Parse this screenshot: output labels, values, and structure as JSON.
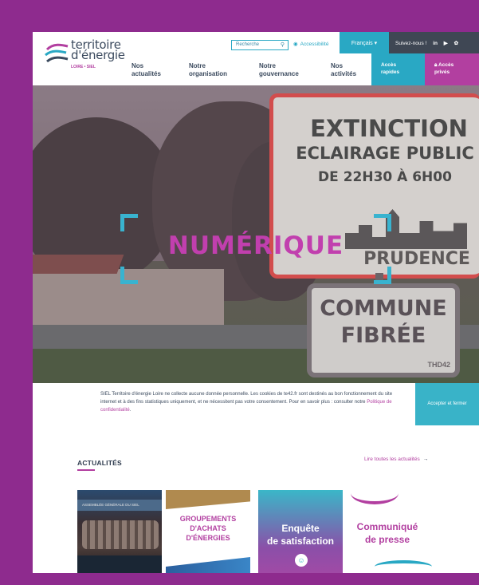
{
  "header": {
    "logo_line1": "territoire",
    "logo_line2": "d'énergie",
    "logo_sub": "LOIRE • SIEL",
    "search_placeholder": "Recherche",
    "accessibility": "Accessibilité",
    "language": "Français ▾",
    "follow": "Suivez-nous !",
    "social": [
      "in",
      "▶",
      "✿"
    ],
    "nav": [
      {
        "line1": "Nos",
        "line2": "actualités"
      },
      {
        "line1": "Notre",
        "line2": "organisation"
      },
      {
        "line1": "Notre",
        "line2": "gouvernance"
      },
      {
        "line1": "Nos",
        "line2": "activités"
      }
    ],
    "quick_access": {
      "line1": "Accès",
      "line2": "rapides"
    },
    "private_access": {
      "line1": "Accès",
      "line2": "privés"
    }
  },
  "hero": {
    "sign1": [
      "EXTINCTION",
      "ECLAIRAGE PUBLIC",
      "DE 22H30 À 6H00",
      "PRUDENCE"
    ],
    "sign2": [
      "COMMUNE",
      "FIBRÉE",
      "THD42"
    ],
    "focus_title": "NUMÉRIQUE"
  },
  "cookie": {
    "text": "SIEL Territoire d'énergie Loire ne collecte aucune donnée personnelle. Les cookies de te42.fr sont destinés au bon fonctionnement du site internet et à des fins statistiques uniquement, et ne nécessitent pas votre consentement. Pour en savoir plus : consulter notre",
    "link": "Politique de confidentialité",
    "button": "Accepter et fermer"
  },
  "news": {
    "title": "ACTUALITÉS",
    "all_link": "Lire toutes les actualités",
    "cards": [
      {
        "banner": "ASSEMBLÉE GÉNÉRALE DU SIEL"
      },
      {
        "line1": "GROUPEMENTS",
        "line2": "D'ACHATS",
        "line3": "D'ÉNERGIES"
      },
      {
        "line1": "Enquête",
        "line2": "de satisfaction"
      },
      {
        "line1": "Communiqué",
        "line2": "de presse"
      }
    ]
  }
}
